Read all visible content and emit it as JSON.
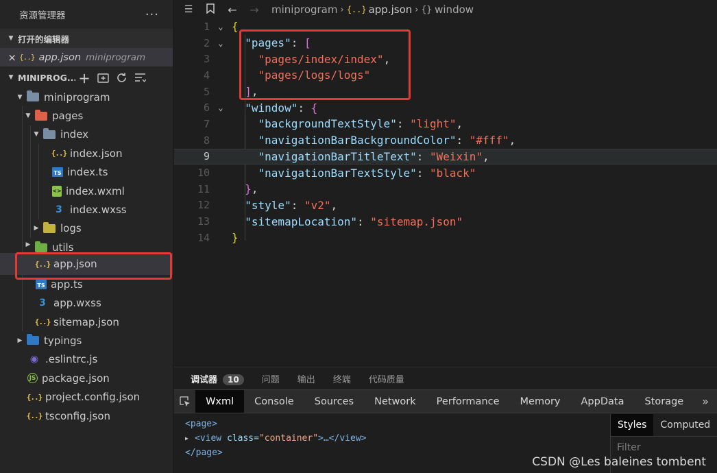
{
  "sidebar": {
    "title": "资源管理器",
    "more": "···",
    "open_editors_label": "打开的编辑器",
    "open_editor": {
      "close": "×",
      "icon": "{..}",
      "name": "app.json",
      "dir": "miniprogram"
    },
    "project_label": "MINIPROG...",
    "tree": [
      {
        "label": "miniprogram",
        "icon": "folder",
        "caret": "▼"
      },
      {
        "label": "pages",
        "icon": "folder-pages",
        "caret": "▼"
      },
      {
        "label": "index",
        "icon": "folder",
        "caret": "▼"
      },
      {
        "label": "index.json",
        "icon": "{..}",
        "caret": ""
      },
      {
        "label": "index.ts",
        "icon": "TS",
        "caret": ""
      },
      {
        "label": "index.wxml",
        "icon": "<>",
        "caret": ""
      },
      {
        "label": "index.wxss",
        "icon": "3",
        "caret": ""
      },
      {
        "label": "logs",
        "icon": "folder-logs",
        "caret": "▶"
      },
      {
        "label": "utils",
        "icon": "folder-utils",
        "caret": "▶"
      },
      {
        "label": "app.json",
        "icon": "{..}",
        "caret": ""
      },
      {
        "label": "app.ts",
        "icon": "TS",
        "caret": ""
      },
      {
        "label": "app.wxss",
        "icon": "3",
        "caret": ""
      },
      {
        "label": "sitemap.json",
        "icon": "{..}",
        "caret": ""
      },
      {
        "label": "typings",
        "icon": "folder-typings",
        "caret": "▶"
      },
      {
        "label": ".eslintrc.js",
        "icon": "◉",
        "caret": ""
      },
      {
        "label": "package.json",
        "icon": "JS",
        "caret": ""
      },
      {
        "label": "project.config.json",
        "icon": "{..}",
        "caret": ""
      },
      {
        "label": "tsconfig.json",
        "icon": "{..}",
        "caret": ""
      }
    ]
  },
  "breadcrumb": {
    "folder": "miniprogram",
    "file_icon": "{..}",
    "file": "app.json",
    "symbol_icon": "{}",
    "symbol": "window"
  },
  "code": {
    "line_numbers": [
      "1",
      "2",
      "3",
      "4",
      "5",
      "6",
      "7",
      "8",
      "9",
      "10",
      "11",
      "12",
      "13",
      "14"
    ],
    "current_line": 9,
    "keys": {
      "pages": "\"pages\"",
      "window": "\"window\"",
      "bgTextStyle": "\"backgroundTextStyle\"",
      "navBg": "\"navigationBarBackgroundColor\"",
      "navTitle": "\"navigationBarTitleText\"",
      "navTextStyle": "\"navigationBarTextStyle\"",
      "style": "\"style\"",
      "sitemap": "\"sitemapLocation\""
    },
    "values": {
      "page1": "\"pages/index/index\"",
      "page2": "\"pages/logs/logs\"",
      "bgTextStyle": "\"light\"",
      "navBg": "\"#fff\"",
      "navTitle": "\"Weixin\"",
      "navTextStyle": "\"black\"",
      "style": "\"v2\"",
      "sitemap": "\"sitemap.json\""
    }
  },
  "debug": {
    "tabs": [
      {
        "label": "调试器",
        "badge": "10"
      },
      {
        "label": "问题"
      },
      {
        "label": "输出"
      },
      {
        "label": "终端"
      },
      {
        "label": "代码质量"
      }
    ],
    "devtools_tabs": [
      "Wxml",
      "Console",
      "Sources",
      "Network",
      "Performance",
      "Memory",
      "AppData",
      "Storage"
    ],
    "more": "»",
    "dom": {
      "open_tag": "<page>",
      "view_tag_open": "<view",
      "attr_name": " class=",
      "attr_value": "\"container\"",
      "view_rest": ">…</view>",
      "close_tag": "</page>"
    },
    "styles_tabs": [
      "Styles",
      "Computed"
    ],
    "filter_placeholder": "Filter"
  },
  "watermark": "CSDN @Les baleines tombent",
  "colors": {
    "highlight_box": "#e53935",
    "string": "#f2705a",
    "key": "#9cdcfe",
    "bracket": "#d6d22f"
  }
}
